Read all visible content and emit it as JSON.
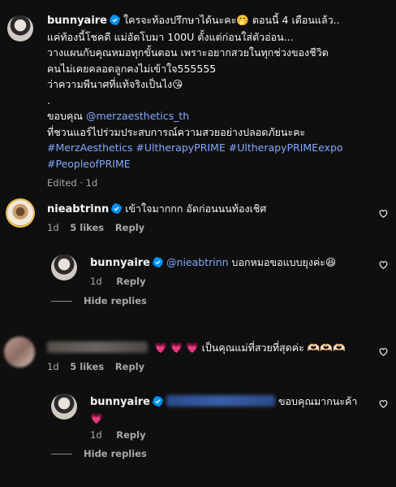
{
  "post": {
    "username": "bunnyaire",
    "lines": [
      "ใครจะท้องปรึกษาได้นะคะ🤭 ตอนนี้ 4 เดือนแล้ว..",
      "แค่ท้องนี้โชคดี แม่อัดโบมา 100U ตั้งแต่ก่อนใส่ตัวอ่อน...",
      "วางแผนกับคุณหมอทุกขั้นตอน เพราะอยากสวยในทุกช่วงของชีวิต",
      "คนไม่เคยคลอดลูกคงไม่เข้าใจ555555",
      "ว่าความพีนาศที่แท้จริงเป็นไง😘",
      ".",
      "ขอบคุณ"
    ],
    "thanks_link": "@merzaesthetics_th",
    "line_invite": "ที่ชวนแอร์ไปร่วมประสบการณ์ความสวยอย่างปลอดภัยนะคะ",
    "hashtags_line1": "#MerzAesthetics #UltherapyPRIME #UltherapyPRIMEexpo",
    "hashtags_line2": "#PeopleofPRIME",
    "meta": "Edited · 1d"
  },
  "comments": [
    {
      "username": "nieabtrinn",
      "text": "เข้าใจมากกก อัดก่อนนนท้องเชิศ",
      "time": "1d",
      "likes": "5 likes",
      "reply": "Reply",
      "replies": [
        {
          "username": "bunnyaire",
          "mention": "@nieabtrinn",
          "text": "บอกหมอขอแบบยุงค่ะ😆",
          "time": "1d",
          "reply": "Reply"
        }
      ],
      "hide_replies": "Hide replies"
    },
    {
      "text": "💗 💗 💗  เป็นคุณแม่ที่สวยที่สุดค่ะ 🫶🏻🫶🏻🫶🏻",
      "time": "1d",
      "likes": "5 likes",
      "reply": "Reply",
      "replies": [
        {
          "username": "bunnyaire",
          "text": "ขอบคุณมากนะค้า",
          "text2": "💗",
          "time": "1d",
          "reply": "Reply"
        }
      ],
      "hide_replies": "Hide replies"
    }
  ],
  "colors": {
    "background": "#0f0f0f",
    "link": "#82a9ff",
    "verified": "#0095f6",
    "muted": "#a8a8a8"
  },
  "icons": [
    "verified-badge-icon",
    "heart-outline-icon"
  ]
}
